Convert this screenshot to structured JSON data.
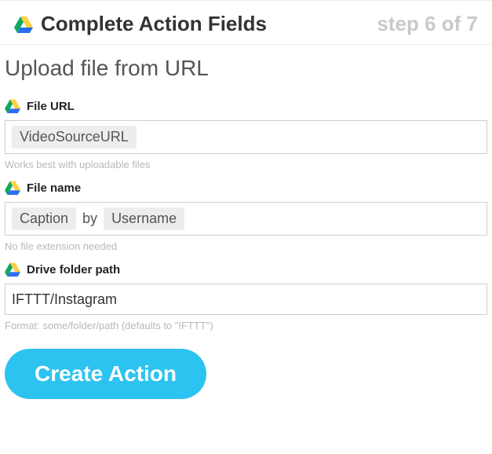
{
  "header": {
    "title": "Complete Action Fields",
    "step": "step 6 of 7"
  },
  "subtitle": "Upload file from URL",
  "fields": {
    "file_url": {
      "label": "File URL",
      "pills": [
        "VideoSourceURL"
      ],
      "hint": "Works best with uploadable files"
    },
    "file_name": {
      "label": "File name",
      "pill1": "Caption",
      "between": "by",
      "pill2": "Username",
      "hint": "No file extension needed"
    },
    "folder_path": {
      "label": "Drive folder path",
      "value": "IFTTT/Instagram",
      "hint": "Format: some/folder/path (defaults to \"IFTTT\")"
    }
  },
  "button": {
    "create": "Create Action"
  }
}
